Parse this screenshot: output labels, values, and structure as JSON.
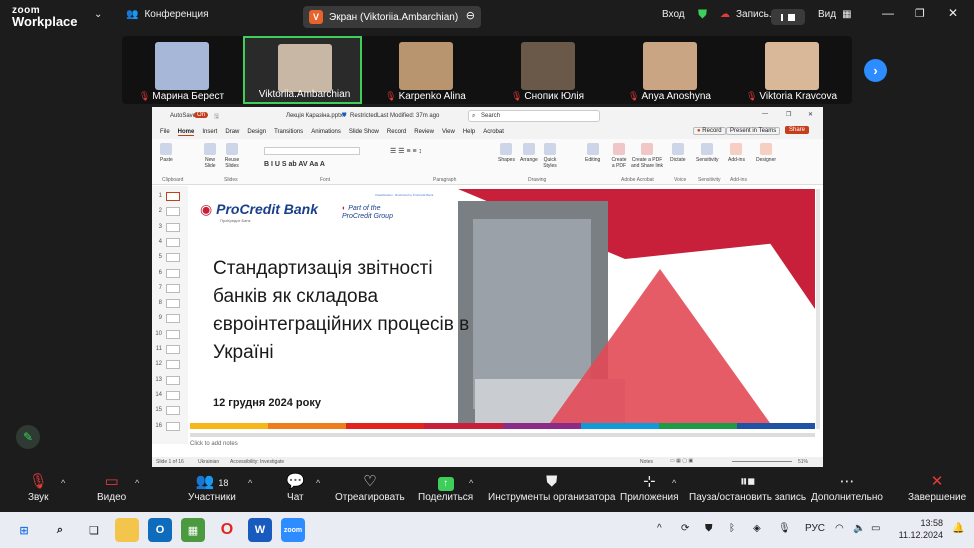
{
  "app": {
    "logo_line1": "zoom",
    "logo_line2": "Workplace",
    "meeting_label": "Конференция",
    "share_chip": "Экран (Viktoriia.Ambarchian)",
    "share_chip_letter": "V",
    "login": "Вход",
    "recording": "Запись...",
    "view": "Вид"
  },
  "participants": [
    {
      "name": "Марина Берест",
      "muted": true,
      "color": "#a7b7d8"
    },
    {
      "name": "Viktoriia.Ambarchian",
      "muted": false,
      "active": true,
      "color": "#c9b7a6"
    },
    {
      "name": "Karpenko Alina",
      "muted": true,
      "color": "#b8956f"
    },
    {
      "name": "Снопик Юлія",
      "muted": true,
      "color": "#6a5848"
    },
    {
      "name": "Anya Anoshyna",
      "muted": true,
      "color": "#c9a583"
    },
    {
      "name": "Viktoria Kravcova",
      "muted": true,
      "color": "#d9b89a"
    }
  ],
  "ppt": {
    "autosave": "AutoSave",
    "toggle": "On",
    "filename": "Лекція Каразіна.pptx",
    "restricted": "Restricted",
    "modified": "Last Modified: 37m ago",
    "search": "Search",
    "menu": [
      "File",
      "Home",
      "Insert",
      "Draw",
      "Design",
      "Transitions",
      "Animations",
      "Slide Show",
      "Record",
      "Review",
      "View",
      "Help",
      "Acrobat"
    ],
    "record_btn": "Record",
    "teams_btn": "Present in Teams",
    "share_btn": "Share",
    "ribbon_groups": [
      "Clipboard",
      "Slides",
      "Font",
      "Paragraph",
      "Drawing",
      "Adobe Acrobat",
      "Voice",
      "Sensitivity",
      "Add-ins"
    ],
    "ribbon_buttons": [
      "Paste",
      "New Slide",
      "Reuse Slides",
      "Shapes",
      "Arrange",
      "Quick Styles",
      "Editing",
      "Create a PDF",
      "Create a PDF and Share link",
      "Dictate",
      "Sensitivity",
      "Add-ins",
      "Designer"
    ],
    "slide_numbers": [
      "1",
      "2",
      "3",
      "4",
      "5",
      "6",
      "7",
      "8",
      "9",
      "10",
      "11",
      "12",
      "13",
      "14",
      "15",
      "16"
    ],
    "notes": "Click to add notes",
    "status_slide": "Slide 1 of 16",
    "status_lang": "Ukrainian",
    "status_access": "Accessibility: Investigate",
    "status_notes": "Notes",
    "zoom": "51%"
  },
  "slide": {
    "classification": "Classification : Restricted to ProCredit Bank",
    "bank": "ProCredit Bank",
    "bank_sub": "ПроКредит Банк",
    "group_line1": "Part of the",
    "group_line2": "ProCredit Group",
    "title": "Стандартизація звітності банків як складова євроінтеграційних процесів в Україні",
    "date": "12 грудня 2024 року",
    "stripe_colors": [
      "#f7b718",
      "#ef7d1a",
      "#e2241c",
      "#c81f3b",
      "#8b2c86",
      "#0f9bd7",
      "#1d9b47",
      "#2053a4"
    ]
  },
  "toolbar": {
    "audio": "Звук",
    "video": "Видео",
    "participants": "Участники",
    "participants_count": "18",
    "chat": "Чат",
    "react": "Отреагировать",
    "share": "Поделиться",
    "host_tools": "Инструменты организатора",
    "apps": "Приложения",
    "pause_rec": "Пауза/остановить запись",
    "more": "Дополнительно",
    "end": "Завершение"
  },
  "taskbar": {
    "lang": "РУС",
    "time": "13:58",
    "date": "11.12.2024"
  }
}
